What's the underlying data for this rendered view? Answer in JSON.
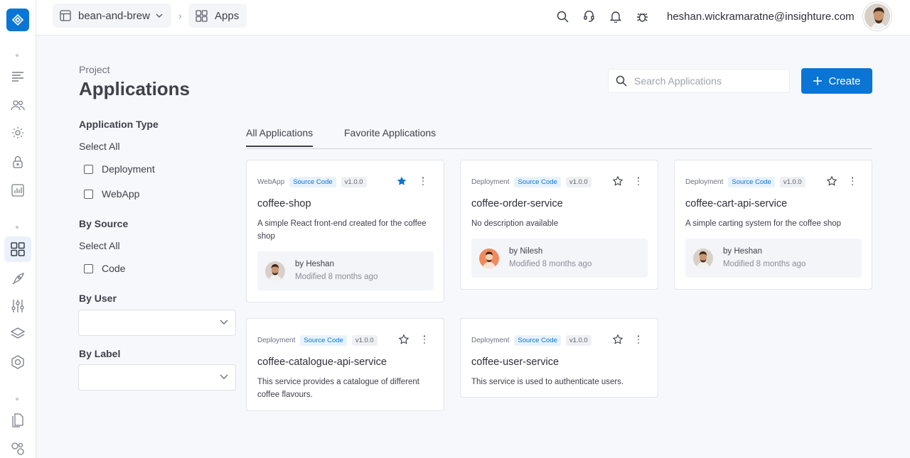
{
  "header": {
    "project_crumb": "bean-and-brew",
    "apps_crumb": "Apps",
    "user_email": "heshan.wickramaratne@insighture.com"
  },
  "page": {
    "project_label": "Project",
    "title": "Applications",
    "search_placeholder": "Search Applications",
    "create_label": "Create"
  },
  "filters": {
    "app_type_heading": "Application Type",
    "app_type_select_all": "Select All",
    "app_types": [
      "Deployment",
      "WebApp"
    ],
    "source_heading": "By Source",
    "source_select_all": "Select All",
    "sources": [
      "Code"
    ],
    "user_heading": "By User",
    "label_heading": "By Label"
  },
  "tabs": [
    "All Applications",
    "Favorite Applications"
  ],
  "cards": [
    {
      "type": "WebApp",
      "source": "Source Code",
      "version": "v1.0.0",
      "favorite": true,
      "name": "coffee-shop",
      "description": "A simple React front-end created for the coffee shop",
      "owner": "by Heshan",
      "modified": "Modified 8 months ago"
    },
    {
      "type": "Deployment",
      "source": "Source Code",
      "version": "v1.0.0",
      "favorite": false,
      "name": "coffee-order-service",
      "description": "No description available",
      "owner": "by Nilesh",
      "modified": "Modified 8 months ago"
    },
    {
      "type": "Deployment",
      "source": "Source Code",
      "version": "v1.0.0",
      "favorite": false,
      "name": "coffee-cart-api-service",
      "description": "A simple carting system for the coffee shop",
      "owner": "by Heshan",
      "modified": "Modified 8 months ago"
    },
    {
      "type": "Deployment",
      "source": "Source Code",
      "version": "v1.0.0",
      "favorite": false,
      "name": "coffee-catalogue-api-service",
      "description": "This service provides a catalogue of different coffee flavours."
    },
    {
      "type": "Deployment",
      "source": "Source Code",
      "version": "v1.0.0",
      "favorite": false,
      "name": "coffee-user-service",
      "description": "This service is used to authenticate users."
    }
  ],
  "colors": {
    "accent": "#0a75d5",
    "favorite_star": "#0a75d5"
  }
}
